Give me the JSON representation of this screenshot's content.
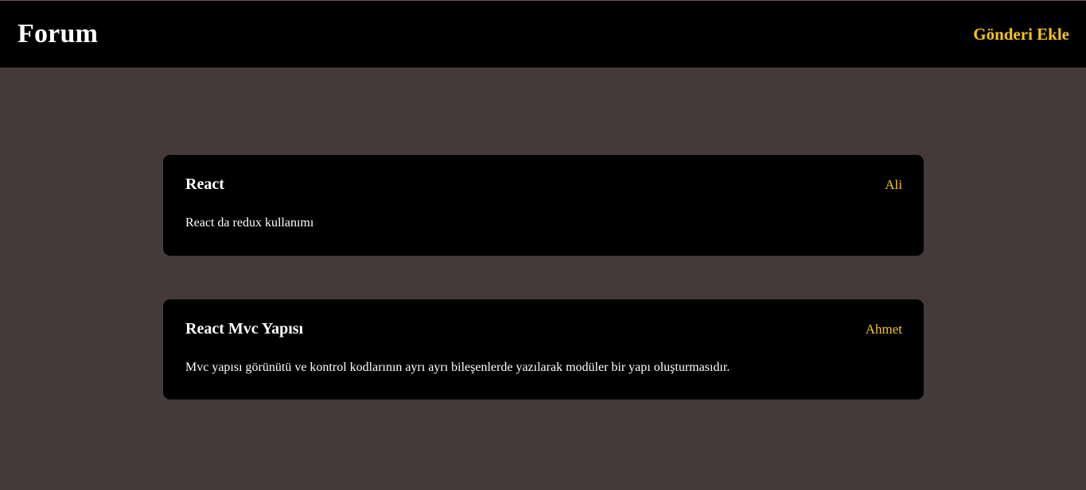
{
  "header": {
    "brand": "Forum",
    "add_post_label": "Gönderi Ekle"
  },
  "posts": [
    {
      "title": "React",
      "author": "Ali",
      "body": "React da redux kullanımı"
    },
    {
      "title": "React Mvc Yapısı",
      "author": "Ahmet",
      "body": "Mvc yapısı görünütü ve kontrol kodlarının ayrı ayrı bileşenlerde yazılarak modüler bir yapı oluşturmasıdır."
    }
  ],
  "colors": {
    "background": "#433a39",
    "header": "#000000",
    "card": "#000000",
    "accent": "#f5c518",
    "text": "#ffffff"
  }
}
